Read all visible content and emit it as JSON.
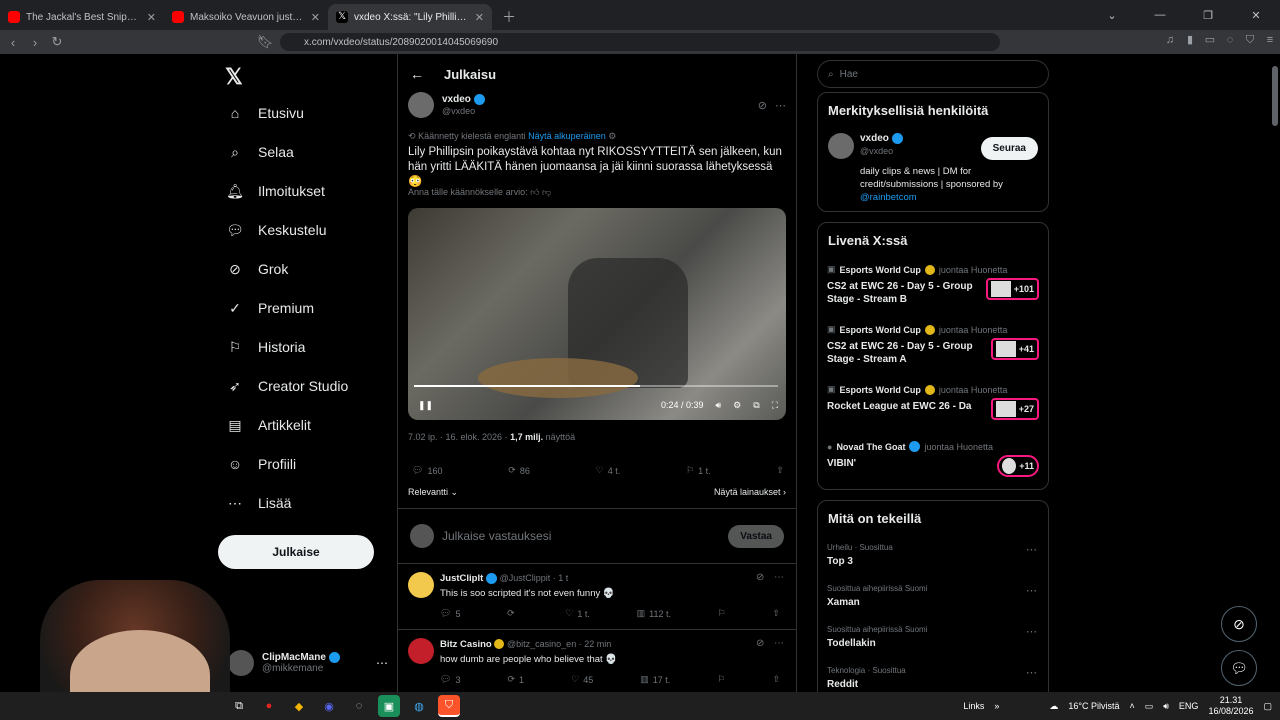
{
  "browser": {
    "tabs": [
      {
        "title": "The Jackal's Best Sniper Kills | The Da",
        "active": false
      },
      {
        "title": "Maksoiko Veavuon just miljoonan vi",
        "active": false
      },
      {
        "title": "vxdeo X:ssä: \"Lily Phillips boy",
        "active": true
      }
    ],
    "url": "x.com/vxdeo/status/2089020014045069690"
  },
  "nav": {
    "items": [
      "Etusivu",
      "Selaa",
      "Ilmoitukset",
      "Keskustelu",
      "Grok",
      "Premium",
      "Historia",
      "Creator Studio",
      "Artikkelit",
      "Profiili",
      "Lisää"
    ],
    "post_button": "Julkaise",
    "account_name": "ClipMacMane",
    "account_handle": "@mikkemane"
  },
  "main": {
    "header_title": "Julkaisu",
    "author_name": "vxdeo",
    "author_handle": "@vxdeo",
    "translated_note": "Käännetty kielestä englanti",
    "show_original": "Näytä alkuperäinen",
    "tweet_text": "Lily Phillipsin poikaystävä kohtaa nyt RIKOSSYYTTEITÄ sen jälkeen, kun hän yritti LÄÄKITÄ hänen juomaansa ja jäi kiinni suorassa lähetyksessä 😳",
    "rate_translation": "Anna tälle käännökselle arvio:",
    "video_time": "0:24 / 0:39",
    "video_progress": 0.62,
    "meta_time": "7.02 ip. · 16. elok. 2026 ·",
    "views": "1,7 milj.",
    "views_label": "näyttöä",
    "stats": {
      "replies": "160",
      "reposts": "86",
      "likes": "4 t.",
      "bookmarks": "1 t."
    },
    "relevance": "Relevantti",
    "show_quotes": "Näytä lainaukset",
    "reply_placeholder": "Julkaise vastauksesi",
    "reply_button": "Vastaa",
    "replies": [
      {
        "name": "JustClipIt",
        "handle": "@JustClippit · 1 t",
        "text": "This is soo scripted it's not even funny 💀",
        "replies": "5",
        "reposts": "",
        "likes": "1 t.",
        "views": "112 t."
      },
      {
        "name": "Bitz Casino",
        "handle": "@bitz_casino_en · 22 min",
        "text": "how dumb are people who believe that 💀",
        "replies": "3",
        "reposts": "1",
        "likes": "45",
        "views": "17 t."
      }
    ]
  },
  "right": {
    "search_placeholder": "Hae",
    "relevant_title": "Merkityksellisiä henkilöitä",
    "relevant_name": "vxdeo",
    "relevant_handle": "@vxdeo",
    "relevant_bio": "daily clips & news | DM for credit/submissions | sponsored by",
    "relevant_link": "@rainbetcom",
    "follow_button": "Seuraa",
    "live_title": "Livenä X:ssä",
    "live": [
      {
        "source": "Esports World Cup",
        "suffix": "juontaa Huonetta",
        "title": "CS2 at EWC 26 - Day 5 - Group Stage - Stream B",
        "count": "+101"
      },
      {
        "source": "Esports World Cup",
        "suffix": "juontaa Huonetta",
        "title": "CS2 at EWC 26 - Day 5 - Group Stage - Stream A",
        "count": "+41"
      },
      {
        "source": "Esports World Cup",
        "suffix": "juontaa Huonetta",
        "title": "Rocket League at EWC 26 - Da",
        "count": "+27"
      },
      {
        "source": "Novad The Goat",
        "suffix": "juontaa Huonetta",
        "title": "VIBIN'",
        "count": "+11"
      }
    ],
    "trends_title": "Mitä on tekeillä",
    "trends": [
      {
        "category": "Urheilu · Suosittua",
        "title": "Top 3"
      },
      {
        "category": "Suosittua aihepiirissä Suomi",
        "title": "Xaman"
      },
      {
        "category": "Suosittua aihepiirissä Suomi",
        "title": "Todellakin"
      },
      {
        "category": "Teknologia · Suosittua",
        "title": "Reddit"
      }
    ]
  },
  "taskbar": {
    "links": "Links",
    "weather": "16°C Pilvistä",
    "lang": "ENG",
    "time": "21.31",
    "date": "16/08/2026"
  },
  "colors": {
    "accent": "#1d9bf0",
    "bg": "#000000",
    "live_border": "#f91880"
  }
}
